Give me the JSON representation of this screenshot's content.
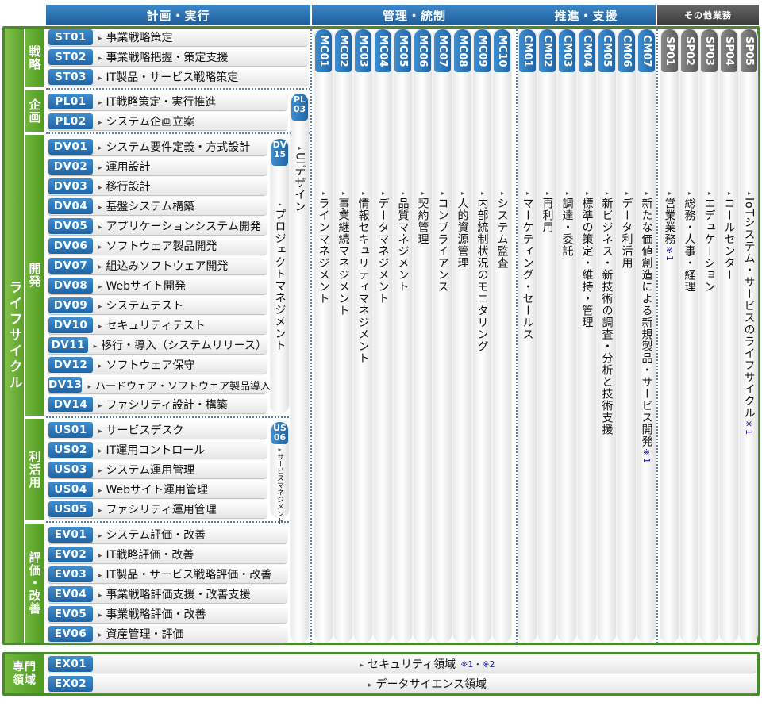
{
  "headers": {
    "plan_exec": "計画・実行",
    "manage": "管理・統制",
    "promote": "推進・支援",
    "other": "その他業務"
  },
  "lifecycle_label": "ライフサイクル",
  "groups": {
    "strategy": "戦略",
    "planning": "企画",
    "development": "開発",
    "utilization": "利活用",
    "evaluation": "評価・改善"
  },
  "rows": [
    {
      "code": "ST01",
      "label": "事業戦略策定"
    },
    {
      "code": "ST02",
      "label": "事業戦略把握・策定支援"
    },
    {
      "code": "ST03",
      "label": "IT製品・サービス戦略策定"
    },
    {
      "code": "PL01",
      "label": "IT戦略策定・実行推進"
    },
    {
      "code": "PL02",
      "label": "システム企画立案"
    },
    {
      "code": "DV01",
      "label": "システム要件定義・方式設計"
    },
    {
      "code": "DV02",
      "label": "運用設計"
    },
    {
      "code": "DV03",
      "label": "移行設計"
    },
    {
      "code": "DV04",
      "label": "基盤システム構築"
    },
    {
      "code": "DV05",
      "label": "アプリケーションシステム開発"
    },
    {
      "code": "DV06",
      "label": "ソフトウェア製品開発"
    },
    {
      "code": "DV07",
      "label": "組込みソフトウェア開発"
    },
    {
      "code": "DV08",
      "label": "Webサイト開発"
    },
    {
      "code": "DV09",
      "label": "システムテスト"
    },
    {
      "code": "DV10",
      "label": "セキュリティテスト"
    },
    {
      "code": "DV11",
      "label": "移行・導入（システムリリース）"
    },
    {
      "code": "DV12",
      "label": "ソフトウェア保守"
    },
    {
      "code": "DV13",
      "label": "ハードウェア・ソフトウェア製品導入"
    },
    {
      "code": "DV14",
      "label": "ファシリティ設計・構築"
    },
    {
      "code": "US01",
      "label": "サービスデスク"
    },
    {
      "code": "US02",
      "label": "IT運用コントロール"
    },
    {
      "code": "US03",
      "label": "システム運用管理"
    },
    {
      "code": "US04",
      "label": "Webサイト運用管理"
    },
    {
      "code": "US05",
      "label": "ファシリティ運用管理"
    },
    {
      "code": "EV01",
      "label": "システム評価・改善"
    },
    {
      "code": "EV02",
      "label": "IT戦略評価・改善"
    },
    {
      "code": "EV03",
      "label": "IT製品・サービス戦略評価・改善"
    },
    {
      "code": "EV04",
      "label": "事業戦略評価支援・改善支援"
    },
    {
      "code": "EV05",
      "label": "事業戦略評価・改善"
    },
    {
      "code": "EV06",
      "label": "資産管理・評価"
    }
  ],
  "pl03": {
    "code": "PL03",
    "label": "UIデザイン"
  },
  "dv15": {
    "code": "DV15",
    "label": "プロジェクトマネジメント"
  },
  "us06": {
    "code": "US06",
    "label": "サービスマネジメント"
  },
  "columns": [
    {
      "code": "MC01",
      "label": "ラインマネジメント",
      "note": ""
    },
    {
      "code": "MC02",
      "label": "事業継続マネジメント",
      "note": ""
    },
    {
      "code": "MC03",
      "label": "情報セキュリティマネジメント",
      "note": ""
    },
    {
      "code": "MC04",
      "label": "データマネジメント",
      "note": ""
    },
    {
      "code": "MC05",
      "label": "品質マネジメント",
      "note": ""
    },
    {
      "code": "MC06",
      "label": "契約管理",
      "note": ""
    },
    {
      "code": "MC07",
      "label": "コンプライアンス",
      "note": ""
    },
    {
      "code": "MC08",
      "label": "人的資源管理",
      "note": ""
    },
    {
      "code": "MC09",
      "label": "内部統制状況のモニタリング",
      "note": ""
    },
    {
      "code": "MC10",
      "label": "システム監査",
      "note": ""
    },
    {
      "code": "CM01",
      "label": "マーケティング・セールス",
      "note": ""
    },
    {
      "code": "CM02",
      "label": "再利用",
      "note": ""
    },
    {
      "code": "CM03",
      "label": "調達・委託",
      "note": ""
    },
    {
      "code": "CM04",
      "label": "標準の策定・維持・管理",
      "note": ""
    },
    {
      "code": "CM05",
      "label": "新ビジネス・新技術の調査・分析と技術支援",
      "note": ""
    },
    {
      "code": "CM06",
      "label": "データ利活用",
      "note": ""
    },
    {
      "code": "CM07",
      "label": "新たな価値創造による新規製品・サービス開発",
      "note": "※1"
    },
    {
      "code": "SP01",
      "label": "営業業務",
      "note": "※1"
    },
    {
      "code": "SP02",
      "label": "総務・人事・経理",
      "note": ""
    },
    {
      "code": "SP03",
      "label": "エデュケーション",
      "note": ""
    },
    {
      "code": "SP04",
      "label": "コールセンター",
      "note": ""
    },
    {
      "code": "SP05",
      "label": "IoTシステム・サービスのライフサイクル",
      "note": "※1"
    }
  ],
  "expert": {
    "label": "専門領域",
    "rows": [
      {
        "code": "EX01",
        "label": "セキュリティ領域",
        "note": "※1・※2"
      },
      {
        "code": "EX02",
        "label": "データサイエンス領域",
        "note": ""
      }
    ]
  }
}
